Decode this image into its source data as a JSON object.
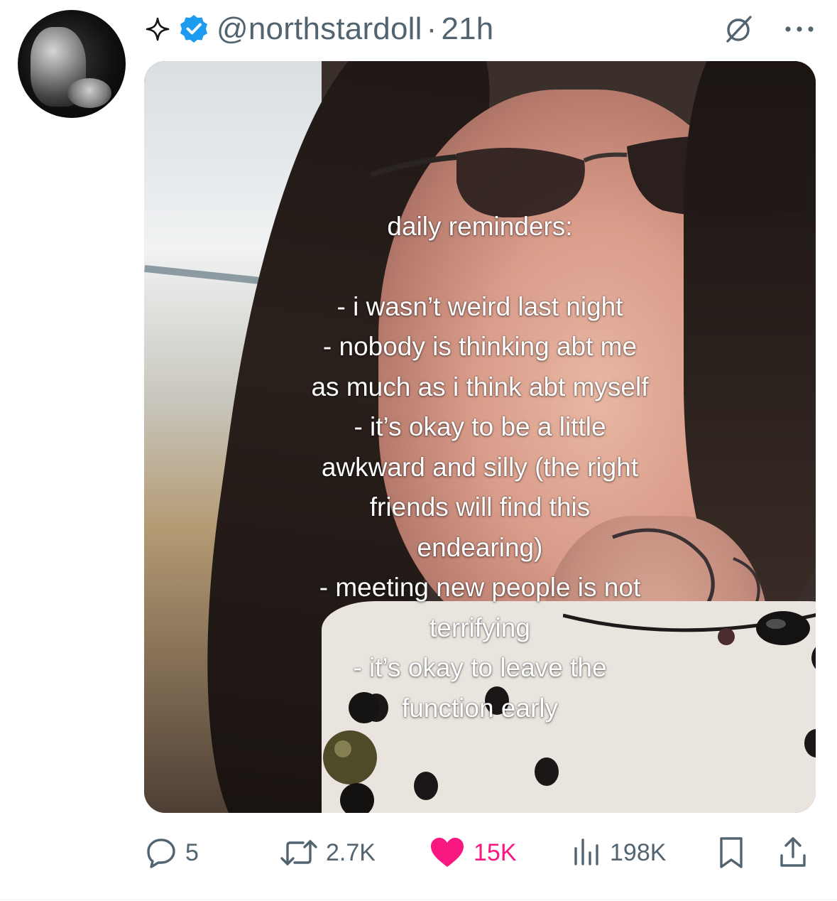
{
  "post": {
    "handle": "@northstardoll",
    "separator": "·",
    "time": "21h"
  },
  "media": {
    "overlay_lines": [
      "daily reminders:",
      "",
      "- i wasn’t weird last night",
      "- nobody is thinking abt me",
      "as much as i think abt myself",
      "- it’s okay to be a little",
      "awkward and silly (the right",
      "friends will find this",
      "endearing)",
      "- meeting new people is not",
      "terrifying",
      "- it’s okay to leave the",
      "function early"
    ]
  },
  "actions": {
    "replies": "5",
    "reposts": "2.7K",
    "likes": "15K",
    "views": "198K"
  },
  "colors": {
    "verified": "#1d9bf0",
    "like": "#f91880",
    "muted": "#536471"
  },
  "icons": {
    "header": [
      "sparkle-icon",
      "verified-icon",
      "grok-icon",
      "more-icon"
    ],
    "actions": [
      "reply-icon",
      "repost-icon",
      "heart-icon",
      "views-icon",
      "bookmark-icon",
      "share-icon"
    ]
  }
}
